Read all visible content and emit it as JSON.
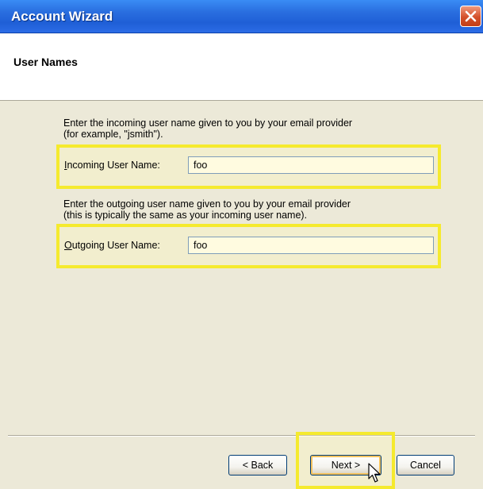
{
  "window": {
    "title": "Account Wizard",
    "close_icon": "close-icon"
  },
  "header": {
    "title": "User Names"
  },
  "incoming": {
    "instruction_line1": "Enter the incoming user name given to you by your email provider",
    "instruction_line2": "(for example, \"jsmith\").",
    "label_accel": "I",
    "label_rest": "ncoming User Name:",
    "value": "foo"
  },
  "outgoing": {
    "instruction_line1": "Enter the outgoing user name given to you by your email provider",
    "instruction_line2": "(this is typically the same as your incoming user name).",
    "label_accel": "O",
    "label_rest": "utgoing User Name:",
    "value": "foo"
  },
  "buttons": {
    "back_label": "< Back",
    "next_label": "Next >",
    "cancel_label": "Cancel"
  },
  "colors": {
    "highlight": "#f5ea2e",
    "titlebar": "#2a6fe0",
    "field_bg": "#fffbe0"
  }
}
